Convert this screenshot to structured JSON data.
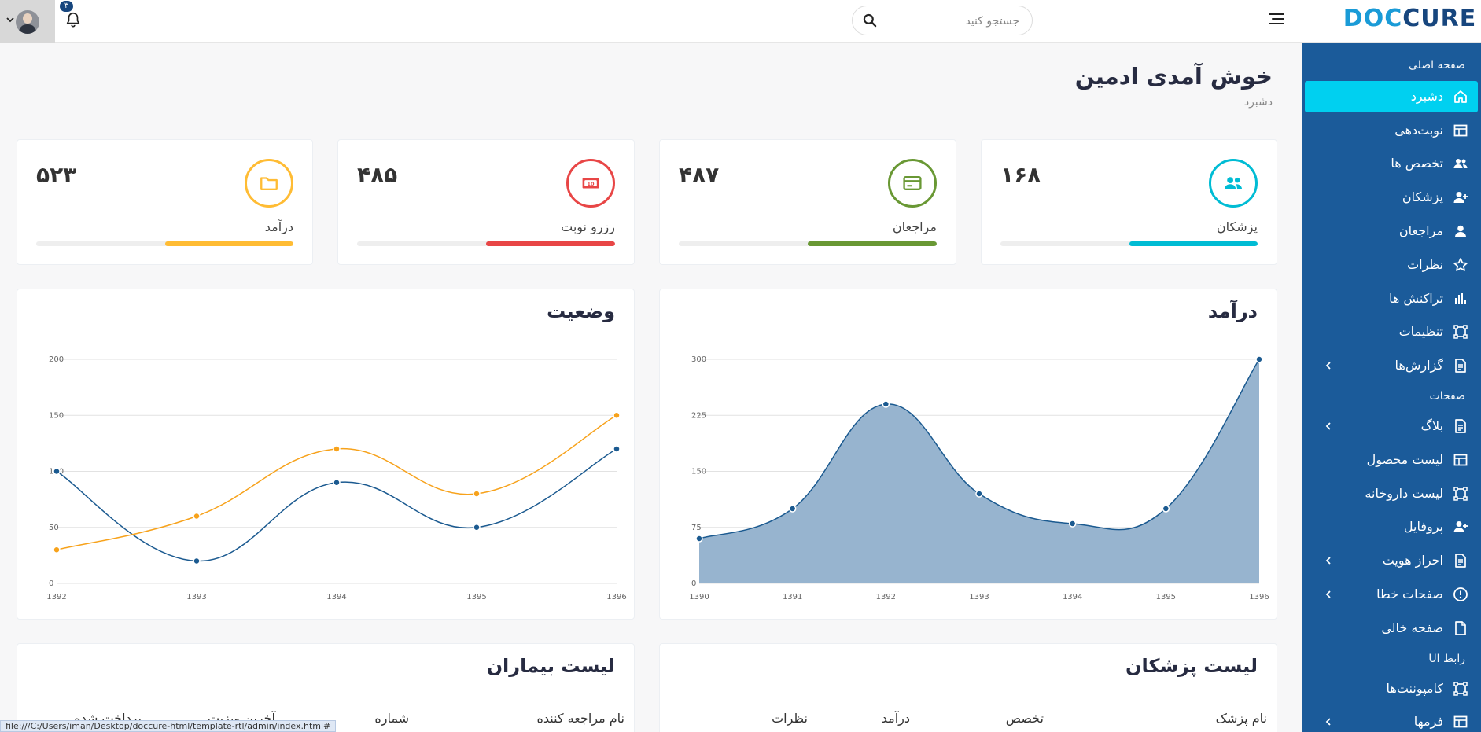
{
  "header": {
    "logo_doc": "DOC",
    "logo_cure": "CURE",
    "search_placeholder": "جستجو کنید",
    "notification_count": "۳"
  },
  "sidebar": {
    "section_main": "صفحه اصلی",
    "section_pages": "صفحات",
    "section_ui": "رابط UI",
    "items": [
      {
        "label": "دشبرد",
        "icon": "home-icon"
      },
      {
        "label": "نوبت‌دهی",
        "icon": "layout-icon"
      },
      {
        "label": "تخصص ها",
        "icon": "users-icon"
      },
      {
        "label": "پزشکان",
        "icon": "user-plus-icon"
      },
      {
        "label": "مراجعان",
        "icon": "user-icon"
      },
      {
        "label": "نظرات",
        "icon": "star-icon"
      },
      {
        "label": "تراکنش ها",
        "icon": "bar-chart-icon"
      },
      {
        "label": "تنظیمات",
        "icon": "frame-icon"
      },
      {
        "label": "گزارش‌ها",
        "icon": "document-icon"
      },
      {
        "label": "بلاگ",
        "icon": "document-icon"
      },
      {
        "label": "لیست محصول",
        "icon": "layout-icon"
      },
      {
        "label": "لیست داروخانه",
        "icon": "frame-icon"
      },
      {
        "label": "پروفایل",
        "icon": "user-plus-icon"
      },
      {
        "label": "احراز هویت",
        "icon": "document-icon"
      },
      {
        "label": "صفحات خطا",
        "icon": "alert-icon"
      },
      {
        "label": "صفحه خالی",
        "icon": "file-icon"
      },
      {
        "label": "کامپوننت‌ها",
        "icon": "frame-icon"
      },
      {
        "label": "فرمها",
        "icon": "layout-icon"
      }
    ]
  },
  "page": {
    "title": "خوش آمدی ادمین",
    "breadcrumb": "دشبرد"
  },
  "stats": [
    {
      "label": "پزشکان",
      "value": "۱۶۸",
      "color": "#00bcd4",
      "progress": 0.5,
      "icon": "users-icon"
    },
    {
      "label": "مراجعان",
      "value": "۴۸۷",
      "color": "#699834",
      "progress": 0.5,
      "icon": "credit-card-icon"
    },
    {
      "label": "رزرو نوبت",
      "value": "۴۸۵",
      "color": "#e84646",
      "progress": 0.5,
      "icon": "money-icon"
    },
    {
      "label": "درآمد",
      "value": "۵۲۳",
      "color": "#ffbc34",
      "progress": 0.5,
      "icon": "folder-icon"
    }
  ],
  "charts": {
    "revenue_title": "درآمد",
    "status_title": "وضعیت"
  },
  "chart_data": [
    {
      "type": "area",
      "title": "درآمد",
      "x": [
        "1390",
        "1391",
        "1392",
        "1393",
        "1394",
        "1395",
        "1396"
      ],
      "values": [
        60,
        100,
        240,
        120,
        80,
        100,
        300
      ],
      "ylim": [
        0,
        300
      ],
      "yticks": [
        "0",
        "75",
        "150",
        "225",
        "300"
      ],
      "color": "#1b5a90",
      "fill": "#97b4cf",
      "grid": true
    },
    {
      "type": "line",
      "title": "وضعیت",
      "x": [
        "1392",
        "1393",
        "1394",
        "1395",
        "1396"
      ],
      "series": [
        {
          "values": [
            100,
            20,
            90,
            50,
            120
          ],
          "color": "#1b5a90"
        },
        {
          "values": [
            30,
            60,
            120,
            80,
            150
          ],
          "color": "#f7a21b"
        }
      ],
      "ylim": [
        0,
        200
      ],
      "yticks": [
        "0",
        "50",
        "100",
        "150",
        "200"
      ],
      "grid": true
    }
  ],
  "doctors_list": {
    "title": "لیست پزشکان",
    "columns": [
      "نام پزشک",
      "تخصص",
      "درآمد",
      "نظرات"
    ]
  },
  "patients_list": {
    "title": "لیست بیماران",
    "columns": [
      "نام مراجعه کننده",
      "شماره",
      "آخرین ویزیت",
      "پرداخت شده"
    ]
  },
  "status_bar": {
    "url": "file:///C:/Users/iman/Desktop/doccure-html/template-rtl/admin/index.html#"
  }
}
